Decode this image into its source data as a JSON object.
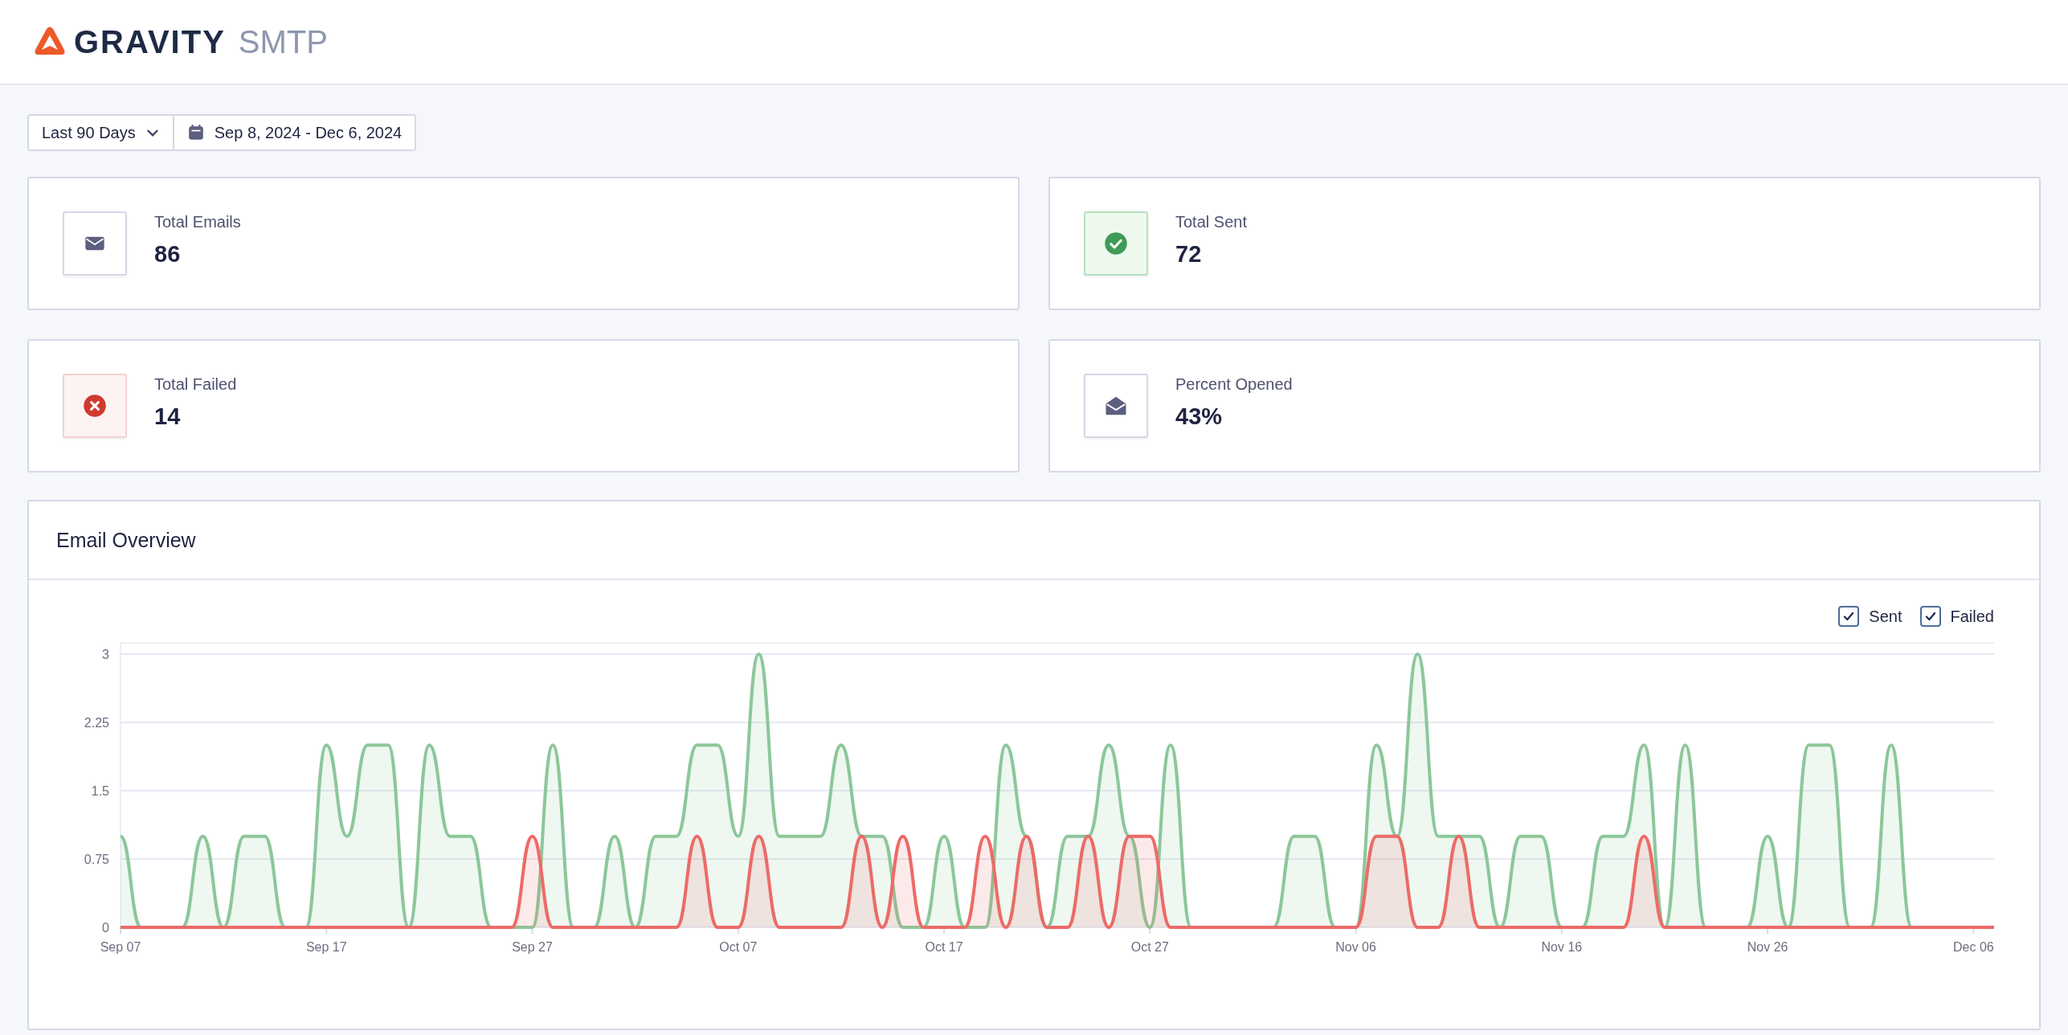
{
  "brand": {
    "name": "GRAVITY",
    "product": "SMTP"
  },
  "filters": {
    "range": "Last 90 Days",
    "dates": "Sep 8, 2024 - Dec 6, 2024"
  },
  "stats": [
    {
      "kind": "total",
      "label": "Total Emails",
      "value": "86"
    },
    {
      "kind": "sent",
      "label": "Total Sent",
      "value": "72"
    },
    {
      "kind": "failed",
      "label": "Total Failed",
      "value": "14"
    },
    {
      "kind": "opened",
      "label": "Percent Opened",
      "value": "43%"
    }
  ],
  "overview": {
    "title": "Email Overview",
    "legend": [
      {
        "checked": true
      },
      {
        "checked": true
      }
    ],
    "chart_data": {
      "type": "area",
      "grid": true,
      "ylim": [
        0,
        3
      ],
      "yticks": [
        0,
        0.75,
        1.5,
        2.25,
        3
      ],
      "categories": [
        "Sep 07",
        null,
        null,
        null,
        null,
        null,
        null,
        null,
        null,
        null,
        "Sep 17",
        null,
        null,
        null,
        null,
        null,
        null,
        null,
        null,
        null,
        "Sep 27",
        null,
        null,
        null,
        null,
        null,
        null,
        null,
        null,
        null,
        "Oct 07",
        null,
        null,
        null,
        null,
        null,
        null,
        null,
        null,
        null,
        "Oct 17",
        null,
        null,
        null,
        null,
        null,
        null,
        null,
        null,
        null,
        "Oct 27",
        null,
        null,
        null,
        null,
        null,
        null,
        null,
        null,
        null,
        "Nov 06",
        null,
        null,
        null,
        null,
        null,
        null,
        null,
        null,
        null,
        "Nov 16",
        null,
        null,
        null,
        null,
        null,
        null,
        null,
        null,
        null,
        "Nov 26",
        null,
        null,
        null,
        null,
        null,
        null,
        null,
        null,
        null,
        "Dec 06",
        null
      ],
      "series": [
        {
          "name": "Sent",
          "color": "#8cc79a",
          "values": [
            1,
            0,
            0,
            0,
            1,
            0,
            1,
            1,
            0,
            0,
            2,
            1,
            2,
            2,
            0,
            2,
            1,
            1,
            0,
            0,
            0,
            2,
            0,
            0,
            1,
            0,
            1,
            1,
            2,
            2,
            1,
            3,
            1,
            1,
            1,
            2,
            1,
            1,
            0,
            0,
            1,
            0,
            0,
            2,
            1,
            0,
            1,
            1,
            2,
            1,
            0,
            2,
            0,
            0,
            0,
            0,
            0,
            1,
            1,
            0,
            0,
            2,
            1,
            3,
            1,
            1,
            1,
            0,
            1,
            1,
            0,
            0,
            1,
            1,
            2,
            0,
            2,
            0,
            0,
            0,
            1,
            0,
            2,
            2,
            0,
            0,
            2,
            0,
            0,
            null,
            null,
            null
          ]
        },
        {
          "name": "Failed",
          "color": "#ec6b67",
          "values": [
            0,
            0,
            0,
            0,
            0,
            0,
            0,
            0,
            0,
            0,
            0,
            0,
            0,
            0,
            0,
            0,
            0,
            0,
            0,
            0,
            1,
            0,
            0,
            0,
            0,
            0,
            0,
            0,
            1,
            0,
            0,
            1,
            0,
            0,
            0,
            0,
            1,
            0,
            1,
            0,
            0,
            0,
            1,
            0,
            1,
            0,
            0,
            1,
            0,
            1,
            1,
            0,
            0,
            0,
            0,
            0,
            0,
            0,
            0,
            0,
            0,
            1,
            1,
            0,
            0,
            1,
            0,
            0,
            0,
            0,
            0,
            0,
            0,
            0,
            1,
            0,
            0,
            0,
            0,
            0,
            0,
            0,
            0,
            0,
            0,
            0,
            0,
            0,
            0,
            0,
            0,
            0
          ]
        }
      ]
    }
  }
}
